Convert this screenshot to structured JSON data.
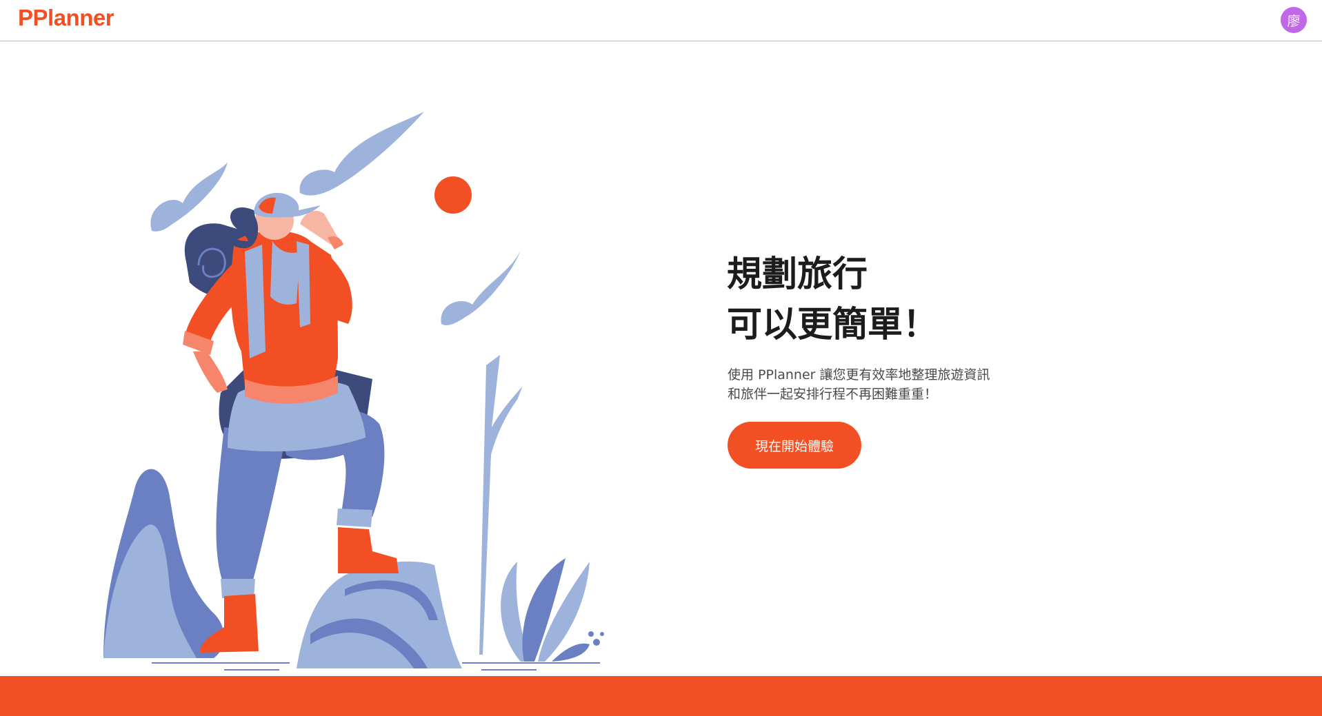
{
  "header": {
    "logo": "PPlanner",
    "avatar_initial": "廖",
    "avatar_color": "#c068e8"
  },
  "hero": {
    "headline_line1": "規劃旅行",
    "headline_line2": "可以更簡單！",
    "description_line1": "使用 PPlanner 讓您更有效率地整理旅遊資訊",
    "description_line2": "和旅伴一起安排行程不再困難重重！",
    "cta_label": "現在開始體驗",
    "illustration": "hiker-illustration"
  },
  "colors": {
    "brand": "#f25024",
    "illustration_light_blue": "#9db3dc",
    "illustration_mid_blue": "#6b80c2",
    "illustration_navy": "#3d4a7c"
  }
}
